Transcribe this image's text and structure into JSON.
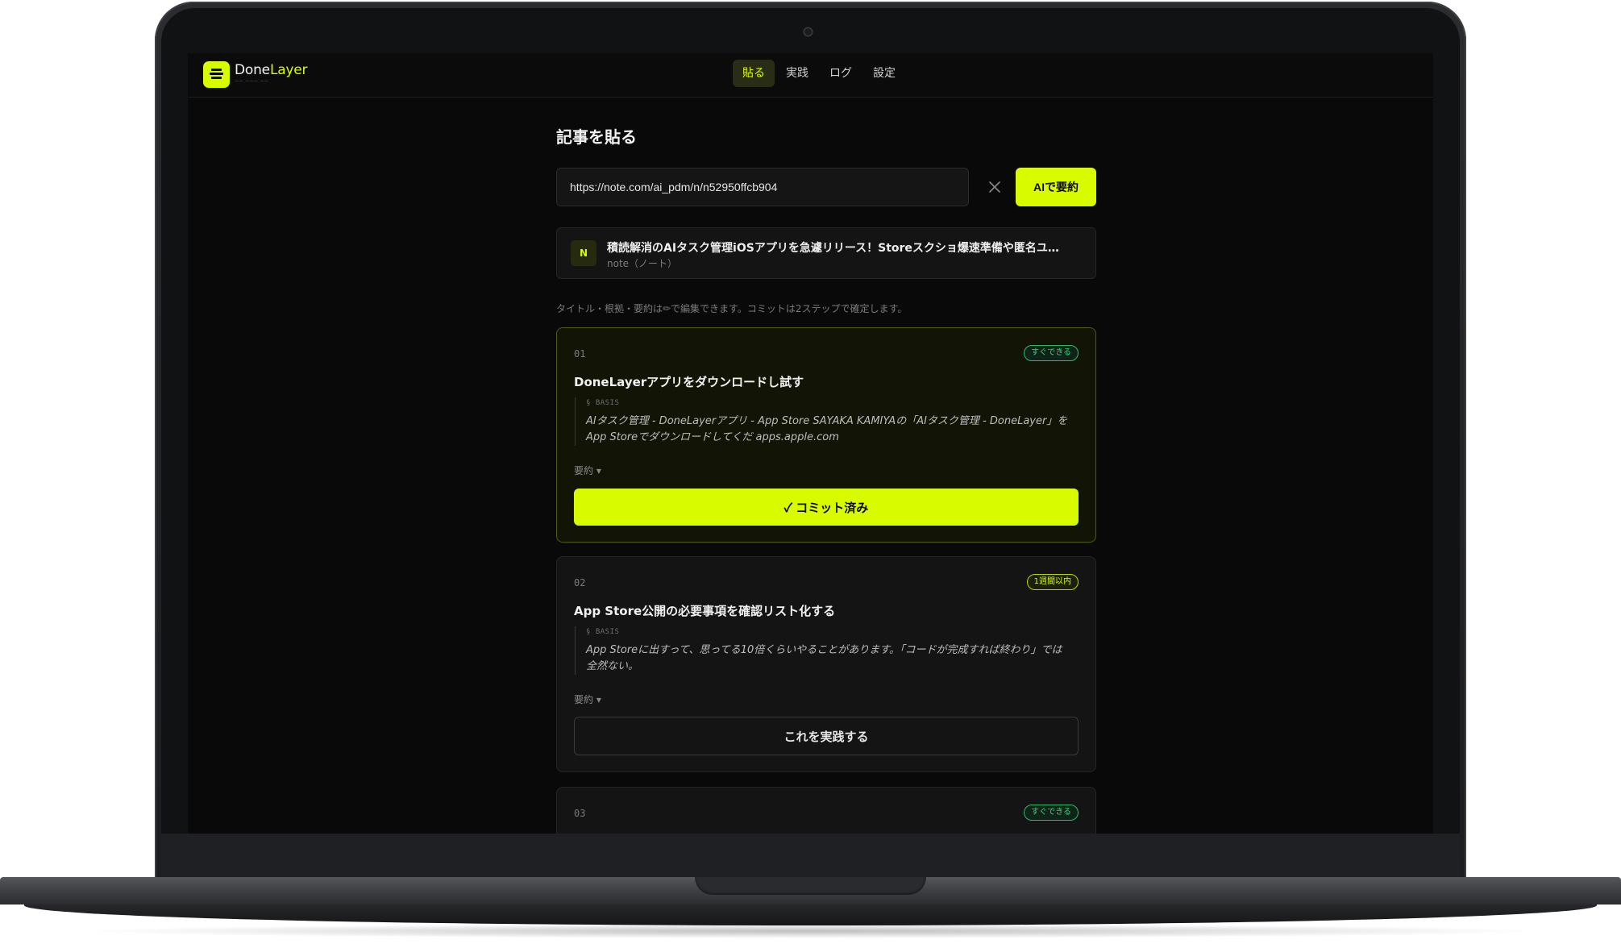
{
  "app": {
    "brand_part1": "Done",
    "brand_part2": "Layer",
    "brand_sub": "—— ——— ——",
    "accent_color": "#d9fb00"
  },
  "nav": {
    "items": [
      {
        "label": "貼る",
        "active": true
      },
      {
        "label": "実践",
        "active": false
      },
      {
        "label": "ログ",
        "active": false
      },
      {
        "label": "設定",
        "active": false
      }
    ]
  },
  "page": {
    "title": "記事を貼る",
    "url_value": "https://note.com/ai_pdm/n/n52950ffcb904",
    "summarize_label": "AIで要約",
    "hint": "タイトル・根拠・要約は✏で編集できます。コミットは2ステップで確定します。"
  },
  "source": {
    "badge": "N",
    "title": "積読解消のAIタスク管理iOSアプリを急遽リリース！Storeスクショ爆速準備や匿名ユ…",
    "subtitle": "note（ノート）"
  },
  "cards": [
    {
      "num": "01",
      "tag": "すぐできる",
      "tag_color": "green",
      "title": "DoneLayerアプリをダウンロードし試す",
      "basis_label": "§ BASIS",
      "basis_text": "AIタスク管理 - DoneLayerアプリ - App Store SAYAKA KAMIYAの「AIタスク管理 - DoneLayer」をApp Storeでダウンロードしてくだ apps.apple.com",
      "summary_label": "要約 ▾",
      "button_label": "✓ コミット済み",
      "committed": true
    },
    {
      "num": "02",
      "tag": "1週間以内",
      "tag_color": "yellow",
      "title": "App Store公開の必要事項を確認リスト化する",
      "basis_label": "§ BASIS",
      "basis_text": "App Storeに出すって、思ってる10倍くらいやることがあります。「コードが完成すれば終わり」では全然ない。",
      "summary_label": "要約 ▾",
      "button_label": "これを実践する",
      "committed": false
    },
    {
      "num": "03",
      "tag": "すぐできる",
      "tag_color": "green"
    }
  ]
}
